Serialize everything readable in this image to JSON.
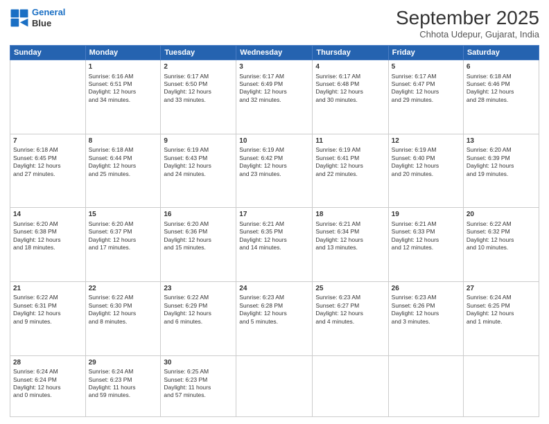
{
  "header": {
    "logo": {
      "line1": "General",
      "line2": "Blue"
    },
    "title": "September 2025",
    "location": "Chhota Udepur, Gujarat, India"
  },
  "weekdays": [
    "Sunday",
    "Monday",
    "Tuesday",
    "Wednesday",
    "Thursday",
    "Friday",
    "Saturday"
  ],
  "weeks": [
    [
      {
        "day": "",
        "content": ""
      },
      {
        "day": "1",
        "content": "Sunrise: 6:16 AM\nSunset: 6:51 PM\nDaylight: 12 hours\nand 34 minutes."
      },
      {
        "day": "2",
        "content": "Sunrise: 6:17 AM\nSunset: 6:50 PM\nDaylight: 12 hours\nand 33 minutes."
      },
      {
        "day": "3",
        "content": "Sunrise: 6:17 AM\nSunset: 6:49 PM\nDaylight: 12 hours\nand 32 minutes."
      },
      {
        "day": "4",
        "content": "Sunrise: 6:17 AM\nSunset: 6:48 PM\nDaylight: 12 hours\nand 30 minutes."
      },
      {
        "day": "5",
        "content": "Sunrise: 6:17 AM\nSunset: 6:47 PM\nDaylight: 12 hours\nand 29 minutes."
      },
      {
        "day": "6",
        "content": "Sunrise: 6:18 AM\nSunset: 6:46 PM\nDaylight: 12 hours\nand 28 minutes."
      }
    ],
    [
      {
        "day": "7",
        "content": "Sunrise: 6:18 AM\nSunset: 6:45 PM\nDaylight: 12 hours\nand 27 minutes."
      },
      {
        "day": "8",
        "content": "Sunrise: 6:18 AM\nSunset: 6:44 PM\nDaylight: 12 hours\nand 25 minutes."
      },
      {
        "day": "9",
        "content": "Sunrise: 6:19 AM\nSunset: 6:43 PM\nDaylight: 12 hours\nand 24 minutes."
      },
      {
        "day": "10",
        "content": "Sunrise: 6:19 AM\nSunset: 6:42 PM\nDaylight: 12 hours\nand 23 minutes."
      },
      {
        "day": "11",
        "content": "Sunrise: 6:19 AM\nSunset: 6:41 PM\nDaylight: 12 hours\nand 22 minutes."
      },
      {
        "day": "12",
        "content": "Sunrise: 6:19 AM\nSunset: 6:40 PM\nDaylight: 12 hours\nand 20 minutes."
      },
      {
        "day": "13",
        "content": "Sunrise: 6:20 AM\nSunset: 6:39 PM\nDaylight: 12 hours\nand 19 minutes."
      }
    ],
    [
      {
        "day": "14",
        "content": "Sunrise: 6:20 AM\nSunset: 6:38 PM\nDaylight: 12 hours\nand 18 minutes."
      },
      {
        "day": "15",
        "content": "Sunrise: 6:20 AM\nSunset: 6:37 PM\nDaylight: 12 hours\nand 17 minutes."
      },
      {
        "day": "16",
        "content": "Sunrise: 6:20 AM\nSunset: 6:36 PM\nDaylight: 12 hours\nand 15 minutes."
      },
      {
        "day": "17",
        "content": "Sunrise: 6:21 AM\nSunset: 6:35 PM\nDaylight: 12 hours\nand 14 minutes."
      },
      {
        "day": "18",
        "content": "Sunrise: 6:21 AM\nSunset: 6:34 PM\nDaylight: 12 hours\nand 13 minutes."
      },
      {
        "day": "19",
        "content": "Sunrise: 6:21 AM\nSunset: 6:33 PM\nDaylight: 12 hours\nand 12 minutes."
      },
      {
        "day": "20",
        "content": "Sunrise: 6:22 AM\nSunset: 6:32 PM\nDaylight: 12 hours\nand 10 minutes."
      }
    ],
    [
      {
        "day": "21",
        "content": "Sunrise: 6:22 AM\nSunset: 6:31 PM\nDaylight: 12 hours\nand 9 minutes."
      },
      {
        "day": "22",
        "content": "Sunrise: 6:22 AM\nSunset: 6:30 PM\nDaylight: 12 hours\nand 8 minutes."
      },
      {
        "day": "23",
        "content": "Sunrise: 6:22 AM\nSunset: 6:29 PM\nDaylight: 12 hours\nand 6 minutes."
      },
      {
        "day": "24",
        "content": "Sunrise: 6:23 AM\nSunset: 6:28 PM\nDaylight: 12 hours\nand 5 minutes."
      },
      {
        "day": "25",
        "content": "Sunrise: 6:23 AM\nSunset: 6:27 PM\nDaylight: 12 hours\nand 4 minutes."
      },
      {
        "day": "26",
        "content": "Sunrise: 6:23 AM\nSunset: 6:26 PM\nDaylight: 12 hours\nand 3 minutes."
      },
      {
        "day": "27",
        "content": "Sunrise: 6:24 AM\nSunset: 6:25 PM\nDaylight: 12 hours\nand 1 minute."
      }
    ],
    [
      {
        "day": "28",
        "content": "Sunrise: 6:24 AM\nSunset: 6:24 PM\nDaylight: 12 hours\nand 0 minutes."
      },
      {
        "day": "29",
        "content": "Sunrise: 6:24 AM\nSunset: 6:23 PM\nDaylight: 11 hours\nand 59 minutes."
      },
      {
        "day": "30",
        "content": "Sunrise: 6:25 AM\nSunset: 6:23 PM\nDaylight: 11 hours\nand 57 minutes."
      },
      {
        "day": "",
        "content": ""
      },
      {
        "day": "",
        "content": ""
      },
      {
        "day": "",
        "content": ""
      },
      {
        "day": "",
        "content": ""
      }
    ]
  ]
}
